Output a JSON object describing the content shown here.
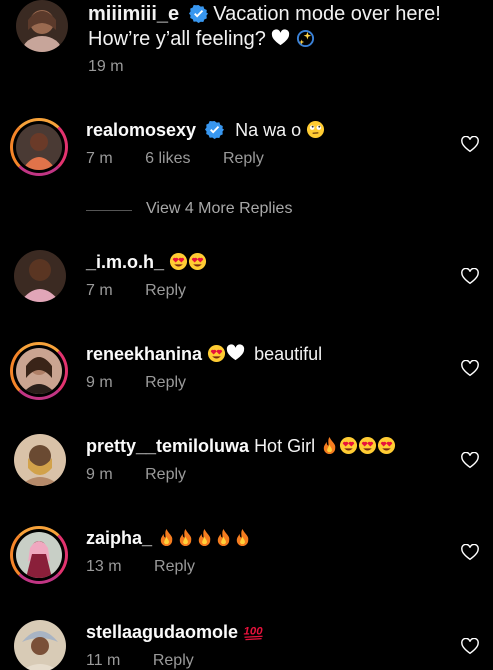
{
  "caption": {
    "username": "miiimiii_e",
    "text_line1": "Vacation mode over here!",
    "text_line2": "How’re y’all feeling?",
    "time": "19 m",
    "avatar_bg": "#7a4a38"
  },
  "view_more": {
    "label": "View 4 More Replies"
  },
  "comments": [
    {
      "username": "realomosexy",
      "verified": true,
      "text": "Na wa o",
      "time": "7 m",
      "likes": "6 likes",
      "reply": "Reply",
      "ring": true,
      "avatar_bg": "#c96a43"
    },
    {
      "username": "_i.m.o.h_",
      "verified": false,
      "text": "",
      "time": "7 m",
      "reply": "Reply",
      "ring": false,
      "avatar_bg": "#5a3a2d"
    },
    {
      "username": "reneekhanina",
      "verified": false,
      "text": "beautiful",
      "time": "9 m",
      "reply": "Reply",
      "ring": true,
      "avatar_bg": "#8a6a58"
    },
    {
      "username": "pretty__temiloluwa",
      "verified": false,
      "text": "Hot Girl",
      "time": "9 m",
      "reply": "Reply",
      "ring": false,
      "avatar_bg": "#c8a184"
    },
    {
      "username": "zaipha_",
      "verified": false,
      "text": "",
      "time": "13 m",
      "reply": "Reply",
      "ring": true,
      "avatar_bg": "#7a2a3a"
    },
    {
      "username": "stellaagudaomole",
      "verified": false,
      "text": "",
      "time": "11 m",
      "reply": "Reply",
      "ring": false,
      "avatar_bg": "#b7a996"
    }
  ],
  "colors": {
    "accent_verified": "#3897f0",
    "secondary_text": "#9a9a9a",
    "background": "#000000"
  },
  "icons": [
    "verified-badge-icon",
    "heart-icon",
    "white-heart-emoji",
    "sparkle-emoji",
    "face-with-rolling-eyes-emoji",
    "heart-eyes-emoji",
    "fire-emoji",
    "hundred-points-emoji"
  ]
}
